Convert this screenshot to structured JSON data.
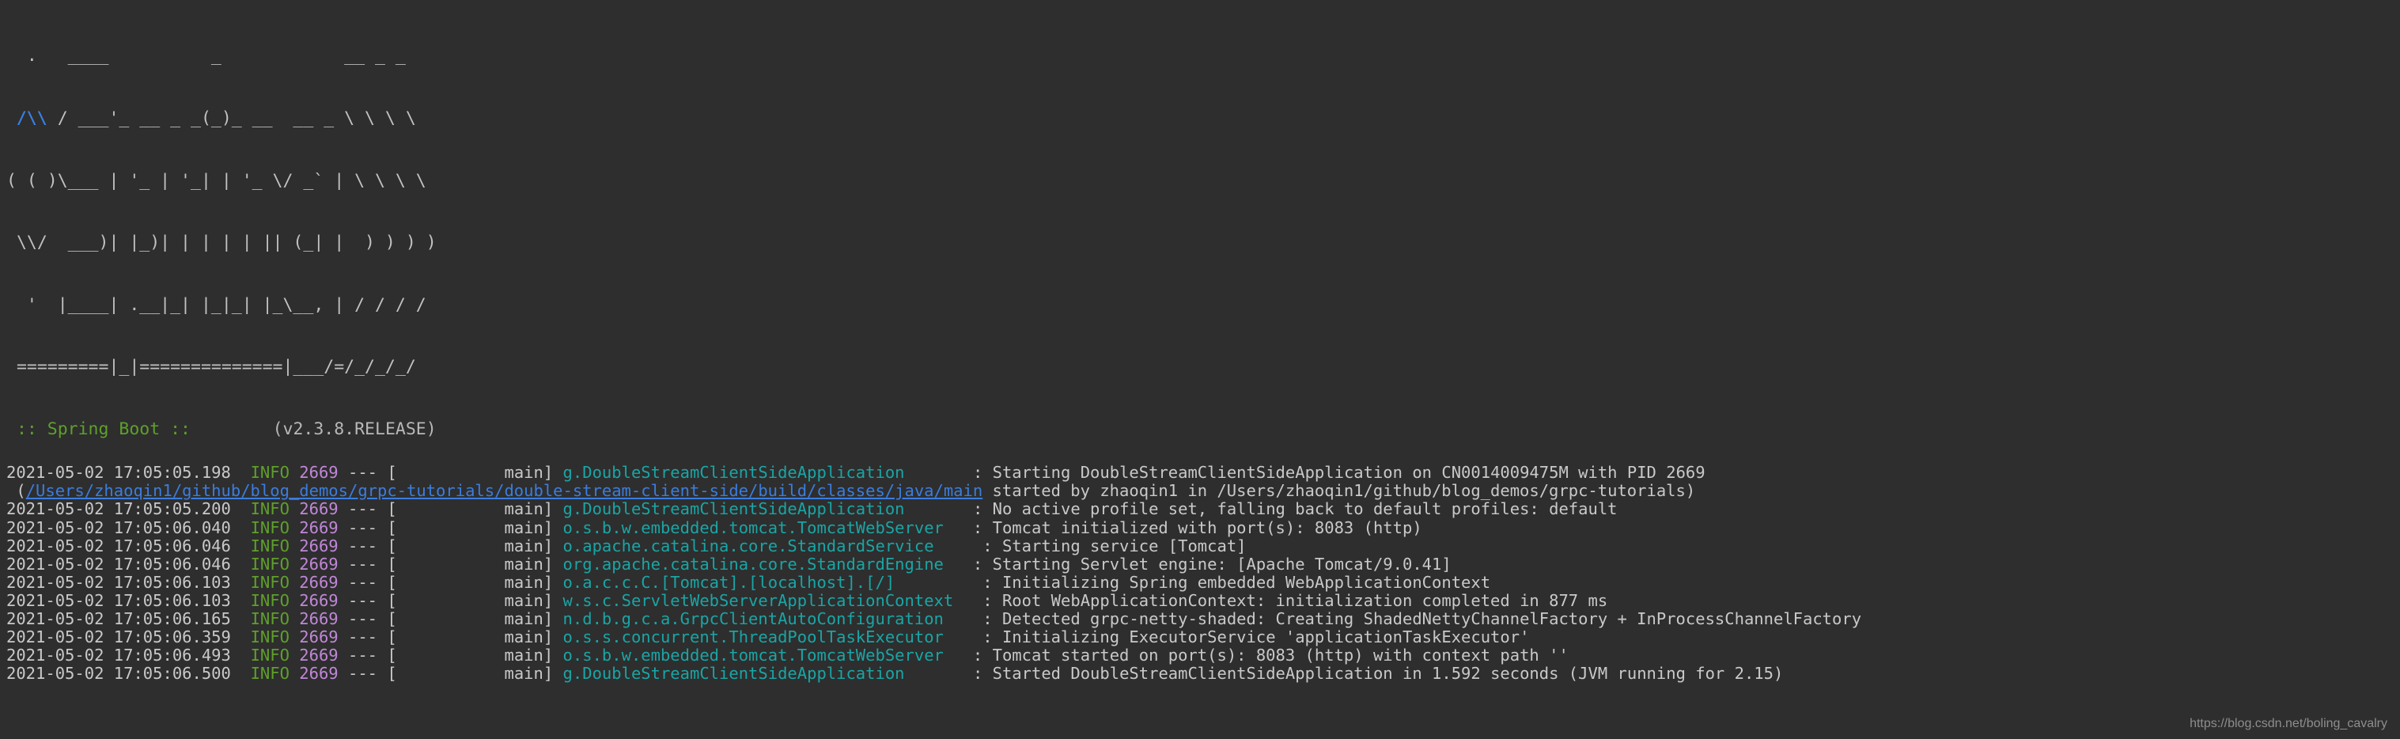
{
  "banner": {
    "lines": [
      "  .   ____          _            __ _ _",
      " /\\\\ / ___'_ __ _ _(_)_ __  __ _ \\ \\ \\ \\",
      "( ( )\\___ | '_ | '_| | '_ \\/ _` | \\ \\ \\ \\",
      " \\\\/  ___)| |_)| | | | | || (_| |  ) ) ) )",
      "  '  |____| .__|_| |_|_| |_\\__, | / / / /",
      " =========|_|==============|___/=/_/_/_/"
    ],
    "leaf_overlay": " /\\\\",
    "footer_name": " :: Spring Boot :: ",
    "footer_spacer": "       ",
    "footer_version": "(v2.3.8.RELEASE)"
  },
  "colors": {
    "background": "#2e2e2e",
    "text": "#c9c9c9",
    "level_info": "#5ea02a",
    "pid": "#c187d8",
    "logger": "#1aa5a5",
    "link": "#3b7ddd",
    "leaf": "#2f7ff0",
    "spring_boot_green": "#5ea02a",
    "watermark": "#8e8e8e"
  },
  "log": {
    "lines": [
      {
        "timestamp": "2021-05-02 17:05:05.198",
        "level": "INFO",
        "pid": "2669",
        "separator": "---",
        "thread": "[           main]",
        "logger": "g.DoubleStreamClientSideApplication",
        "logger_pad": "    ",
        "colon": ": ",
        "message": "Starting DoubleStreamClientSideApplication on CN0014009475M with PID 2669"
      },
      {
        "continuation": true,
        "prefix": " (",
        "link": "/Users/zhaoqin1/github/blog_demos/grpc-tutorials/double-stream-client-side/build/classes/java/main",
        "suffix": " started by zhaoqin1 in /Users/zhaoqin1/github/blog_demos/grpc-tutorials)"
      },
      {
        "timestamp": "2021-05-02 17:05:05.200",
        "level": "INFO",
        "pid": "2669",
        "separator": "---",
        "thread": "[           main]",
        "logger": "g.DoubleStreamClientSideApplication",
        "logger_pad": "    ",
        "colon": ": ",
        "message": "No active profile set, falling back to default profiles: default"
      },
      {
        "timestamp": "2021-05-02 17:05:06.040",
        "level": "INFO",
        "pid": "2669",
        "separator": "---",
        "thread": "[           main]",
        "logger": "o.s.b.w.embedded.tomcat.TomcatWebServer",
        "logger_pad": "",
        "colon": ": ",
        "message": "Tomcat initialized with port(s): 8083 (http)"
      },
      {
        "timestamp": "2021-05-02 17:05:06.046",
        "level": "INFO",
        "pid": "2669",
        "separator": "---",
        "thread": "[           main]",
        "logger": "o.apache.catalina.core.StandardService",
        "logger_pad": "  ",
        "colon": ": ",
        "message": "Starting service [Tomcat]"
      },
      {
        "timestamp": "2021-05-02 17:05:06.046",
        "level": "INFO",
        "pid": "2669",
        "separator": "---",
        "thread": "[           main]",
        "logger": "org.apache.catalina.core.StandardEngine",
        "logger_pad": "",
        "colon": ": ",
        "message": "Starting Servlet engine: [Apache Tomcat/9.0.41]"
      },
      {
        "timestamp": "2021-05-02 17:05:06.103",
        "level": "INFO",
        "pid": "2669",
        "separator": "---",
        "thread": "[           main]",
        "logger": "o.a.c.c.C.[Tomcat].[localhost].[/]",
        "logger_pad": "      ",
        "colon": ": ",
        "message": "Initializing Spring embedded WebApplicationContext"
      },
      {
        "timestamp": "2021-05-02 17:05:06.103",
        "level": "INFO",
        "pid": "2669",
        "separator": "---",
        "thread": "[           main]",
        "logger": "w.s.c.ServletWebServerApplicationContext",
        "logger_pad": "",
        "colon": ": ",
        "message": "Root WebApplicationContext: initialization completed in 877 ms"
      },
      {
        "timestamp": "2021-05-02 17:05:06.165",
        "level": "INFO",
        "pid": "2669",
        "separator": "---",
        "thread": "[           main]",
        "logger": "n.d.b.g.c.a.GrpcClientAutoConfiguration",
        "logger_pad": " ",
        "colon": ": ",
        "message": "Detected grpc-netty-shaded: Creating ShadedNettyChannelFactory + InProcessChannelFactory"
      },
      {
        "timestamp": "2021-05-02 17:05:06.359",
        "level": "INFO",
        "pid": "2669",
        "separator": "---",
        "thread": "[           main]",
        "logger": "o.s.s.concurrent.ThreadPoolTaskExecutor",
        "logger_pad": " ",
        "colon": ": ",
        "message": "Initializing ExecutorService 'applicationTaskExecutor'"
      },
      {
        "timestamp": "2021-05-02 17:05:06.493",
        "level": "INFO",
        "pid": "2669",
        "separator": "---",
        "thread": "[           main]",
        "logger": "o.s.b.w.embedded.tomcat.TomcatWebServer",
        "logger_pad": "",
        "colon": ": ",
        "message": "Tomcat started on port(s): 8083 (http) with context path ''"
      },
      {
        "timestamp": "2021-05-02 17:05:06.500",
        "level": "INFO",
        "pid": "2669",
        "separator": "---",
        "thread": "[           main]",
        "logger": "g.DoubleStreamClientSideApplication",
        "logger_pad": "    ",
        "colon": ": ",
        "message": "Started DoubleStreamClientSideApplication in 1.592 seconds (JVM running for 2.15)"
      }
    ]
  },
  "watermark": {
    "text": "https://blog.csdn.net/boling_cavalry"
  }
}
